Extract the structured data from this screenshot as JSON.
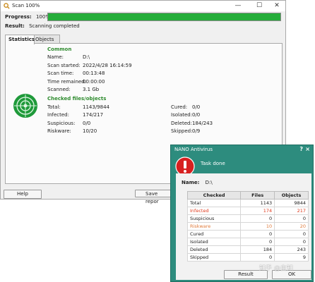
{
  "window": {
    "title": "Scan 100%",
    "progress_label": "Progress:",
    "progress_value": "100%",
    "progress_fraction": 1.0,
    "result_label": "Result:",
    "result_value": "Scanning completed"
  },
  "tabs": [
    "Statistics",
    "Objects"
  ],
  "common": {
    "heading": "Common",
    "rows": [
      {
        "label": "Name:",
        "value": "D:\\"
      },
      {
        "label": "Scan started:",
        "value": "2022/4/28 16:14:59"
      },
      {
        "label": "Scan time:",
        "value": "00:13:48"
      },
      {
        "label": "Time remained:",
        "value": "00:00:00"
      },
      {
        "label": "Scanned:",
        "value": "3.1 Gb"
      }
    ]
  },
  "checked": {
    "heading": "Checked files/objects",
    "left": [
      {
        "label": "Total:",
        "value": "1143/9844"
      },
      {
        "label": "Infected:",
        "value": "174/217"
      },
      {
        "label": "Suspicious:",
        "value": "0/0"
      },
      {
        "label": "Riskware:",
        "value": "10/20"
      }
    ],
    "right": [
      {
        "label": "Cured:",
        "value": "0/0"
      },
      {
        "label": "Isolated:",
        "value": "0/0"
      },
      {
        "label": "Deleted:",
        "value": "184/243"
      },
      {
        "label": "Skipped:",
        "value": "0/9"
      }
    ]
  },
  "buttons": {
    "help": "Help",
    "save_report": "Save repor"
  },
  "dialog": {
    "title": "NANO Antivirus",
    "help_glyph": "?",
    "close_glyph": "×",
    "message": "Task done",
    "name_label": "Name:",
    "name_value": "D:\\",
    "columns": [
      "Checked",
      "Files",
      "Objects"
    ],
    "rows": [
      {
        "label": "Total",
        "files": "1143",
        "objects": "9844"
      },
      {
        "label": "Infected",
        "files": "174",
        "objects": "217"
      },
      {
        "label": "Suspicious",
        "files": "0",
        "objects": "0"
      },
      {
        "label": "Riskware",
        "files": "10",
        "objects": "20"
      },
      {
        "label": "Cured",
        "files": "0",
        "objects": "0"
      },
      {
        "label": "Isolated",
        "files": "0",
        "objects": "0"
      },
      {
        "label": "Deleted",
        "files": "184",
        "objects": "243"
      },
      {
        "label": "Skipped",
        "files": "0",
        "objects": "9"
      }
    ],
    "buttons": {
      "result": "Result",
      "ok": "OK"
    },
    "watermark": "知乎 @自知"
  },
  "colors": {
    "progress": "#25ad3a",
    "section": "#2e8b2e",
    "dialog": "#2d8c7e",
    "danger": "#e03b1e"
  }
}
